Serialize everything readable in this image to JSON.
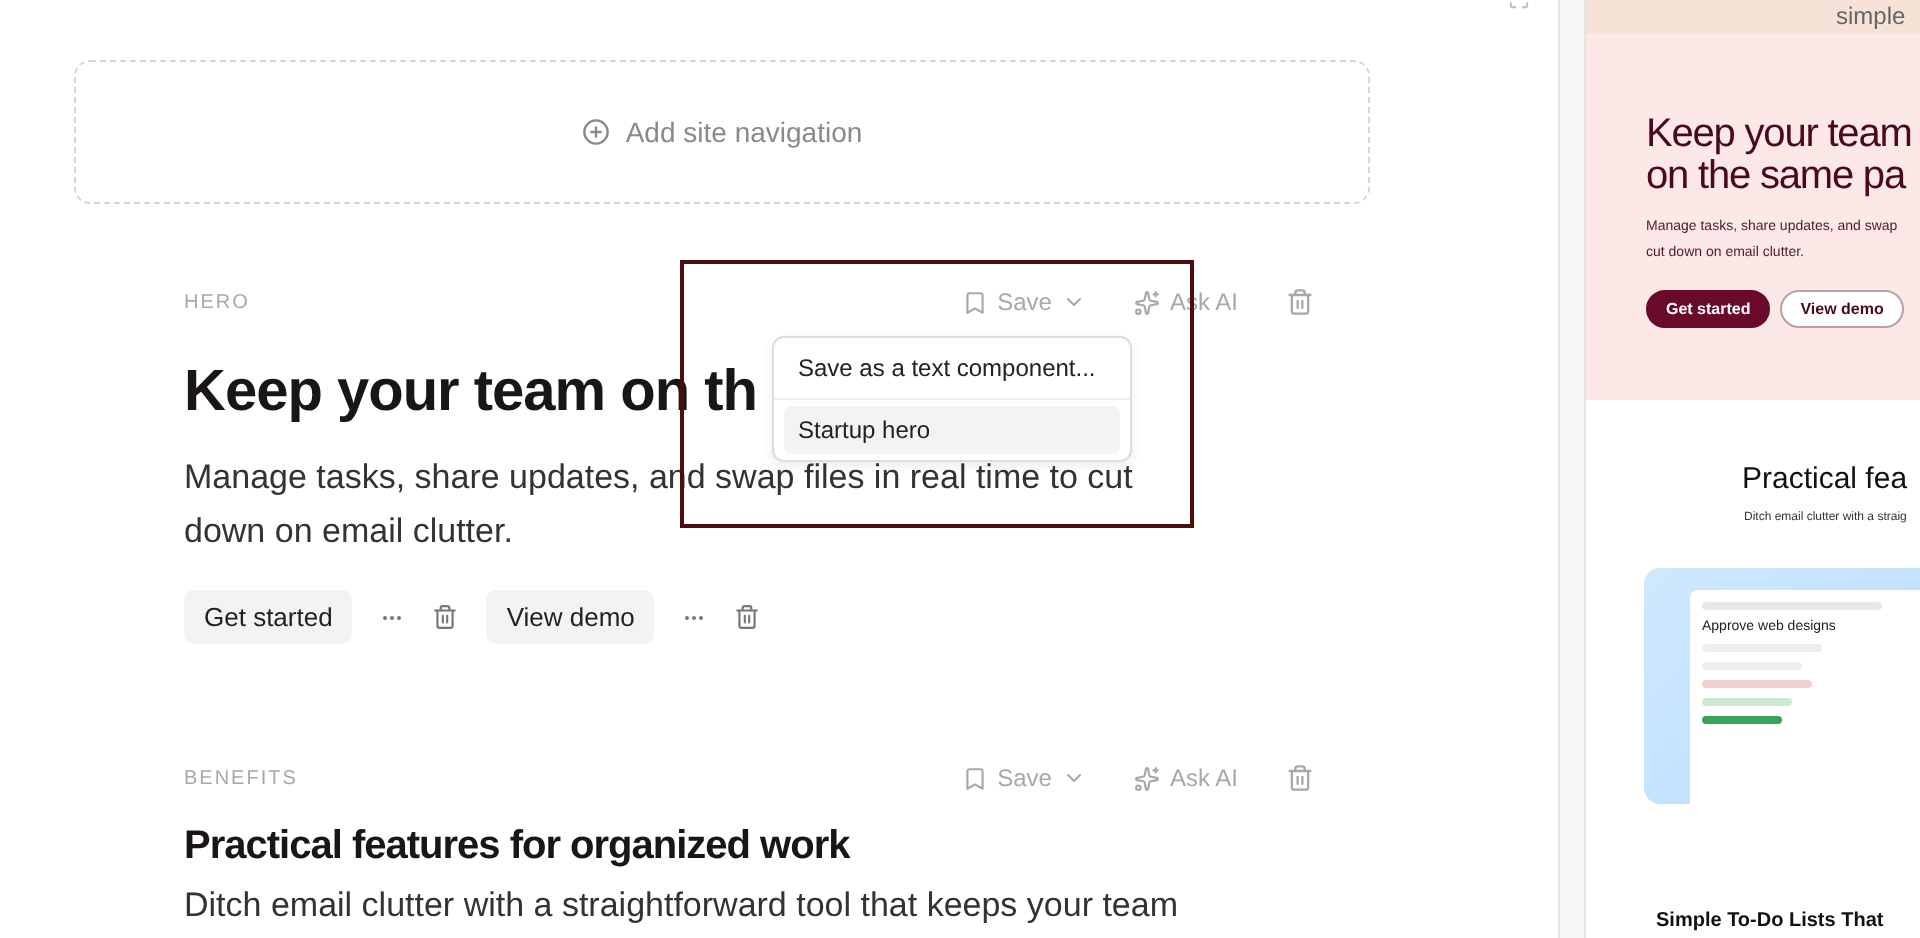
{
  "nav": {
    "label": "Add site navigation"
  },
  "sections": [
    {
      "kind": "hero",
      "label": "HERO",
      "save": "Save",
      "ask": "Ask AI",
      "heading": "Keep your team on th",
      "paragraph": "Manage tasks, share updates, and swap files in real time to cut down on email clutter.",
      "buttons": [
        "Get started",
        "View demo"
      ]
    },
    {
      "kind": "feature",
      "label": "BENEFITS",
      "save": "Save",
      "ask": "Ask AI",
      "heading": "Practical features for organized work",
      "paragraph": "Ditch email clutter with a straightforward tool that keeps your team"
    }
  ],
  "menu": {
    "items": [
      {
        "label": "Save as a text component...",
        "selected": false
      },
      {
        "label": "Startup hero",
        "selected": true
      }
    ]
  },
  "preview": {
    "title": "simple",
    "hero_lines": [
      "Keep your team",
      "on the same pa"
    ],
    "hero_text_lines": [
      "Manage tasks, share updates, and swap",
      "cut down on email clutter."
    ],
    "primary": "Get started",
    "secondary": "View demo",
    "features_title": "Practical fea",
    "features_text": "Ditch email clutter with a straig",
    "mock_title": "Approve web designs",
    "next_title": "Simple To-Do Lists That"
  }
}
